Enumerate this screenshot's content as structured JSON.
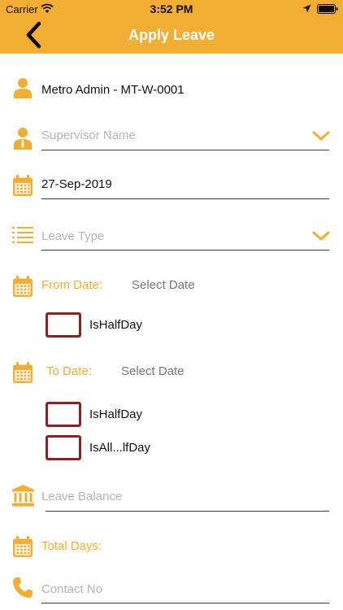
{
  "status_bar": {
    "carrier": "Carrier",
    "time": "3:52 PM"
  },
  "header": {
    "title": "Apply Leave",
    "back_icon": "chevron-left-icon"
  },
  "colors": {
    "accent": "#F2AD33",
    "checkbox_border": "#8e2121",
    "placeholder": "#b4b4b4"
  },
  "form": {
    "user_name": "Metro Admin - MT-W-0001",
    "supervisor_placeholder": "Supervisor Name",
    "date": "27-Sep-2019",
    "leave_type_placeholder": "Leave Type",
    "from_date_label": "From Date:",
    "from_date_value": "Select Date",
    "from_half_day_label": "IsHalfDay",
    "to_date_label": "To Date:",
    "to_date_value": "Select Date",
    "to_half_day_label": "IsHalfDay",
    "to_all_half_day_label": "IsAll...lfDay",
    "leave_balance_placeholder": "Leave Balance",
    "total_days_label": "Total Days:",
    "contact_placeholder": "Contact No"
  }
}
